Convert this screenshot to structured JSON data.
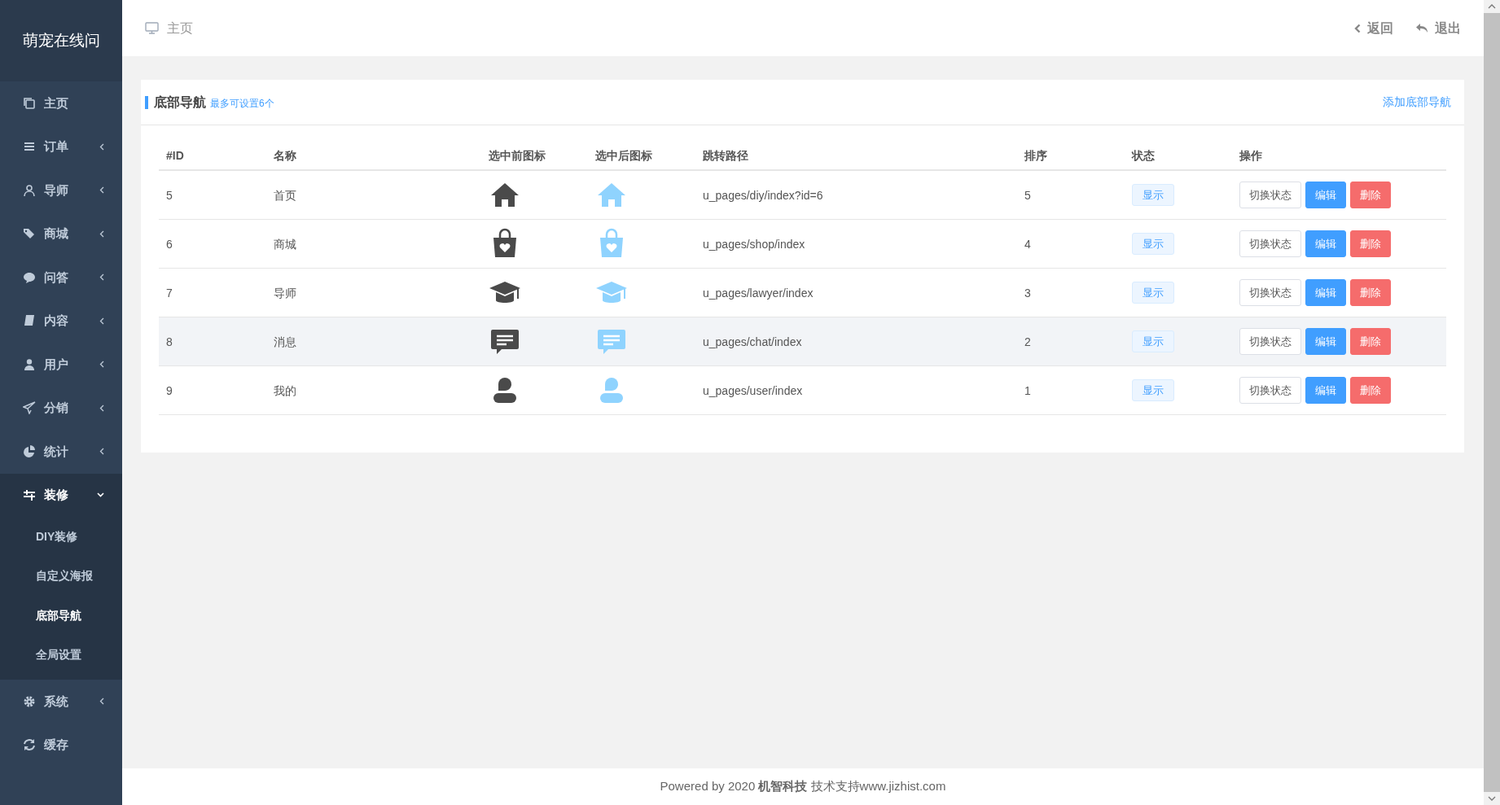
{
  "sidebar": {
    "logo": "萌宠在线问",
    "items": [
      {
        "label": "主页",
        "kind": "copy",
        "has_arrow": false,
        "expanded": false
      },
      {
        "label": "订单",
        "kind": "list",
        "has_arrow": true,
        "expanded": false
      },
      {
        "label": "导师",
        "kind": "user",
        "has_arrow": true,
        "expanded": false
      },
      {
        "label": "商城",
        "kind": "tags",
        "has_arrow": true,
        "expanded": false
      },
      {
        "label": "问答",
        "kind": "comment",
        "has_arrow": true,
        "expanded": false
      },
      {
        "label": "内容",
        "kind": "book",
        "has_arrow": true,
        "expanded": false
      },
      {
        "label": "用户",
        "kind": "person",
        "has_arrow": true,
        "expanded": false
      },
      {
        "label": "分销",
        "kind": "plane",
        "has_arrow": true,
        "expanded": false
      },
      {
        "label": "统计",
        "kind": "pie",
        "has_arrow": true,
        "expanded": false
      },
      {
        "label": "装修",
        "kind": "sliders",
        "has_arrow": true,
        "expanded": true,
        "children": [
          {
            "label": "DIY装修",
            "selected": false
          },
          {
            "label": "自定义海报",
            "selected": false
          },
          {
            "label": "底部导航",
            "selected": true
          },
          {
            "label": "全局设置",
            "selected": false
          }
        ]
      },
      {
        "label": "系统",
        "kind": "gear",
        "has_arrow": true,
        "expanded": false
      },
      {
        "label": "缓存",
        "kind": "refresh",
        "has_arrow": false,
        "expanded": false
      }
    ]
  },
  "header": {
    "breadcrumb": "主页",
    "back": "返回",
    "logout": "退出"
  },
  "card": {
    "title": "底部导航",
    "hint": "最多可设置6个",
    "add_link": "添加底部导航",
    "table": {
      "columns": [
        "#ID",
        "名称",
        "选中前图标",
        "选中后图标",
        "跳转路径",
        "排序",
        "状态",
        "操作"
      ],
      "rows": [
        {
          "id": "5",
          "name": "首页",
          "kind": "house",
          "path": "u_pages/diy/index?id=6",
          "sort": "5",
          "status": "显示",
          "highlighted": false,
          "actions": [
            "切换状态",
            "编辑",
            "删除"
          ]
        },
        {
          "id": "6",
          "name": "商城",
          "kind": "bag",
          "path": "u_pages/shop/index",
          "sort": "4",
          "status": "显示",
          "highlighted": false,
          "actions": [
            "切换状态",
            "编辑",
            "删除"
          ]
        },
        {
          "id": "7",
          "name": "导师",
          "kind": "cap",
          "path": "u_pages/lawyer/index",
          "sort": "3",
          "status": "显示",
          "highlighted": false,
          "actions": [
            "切换状态",
            "编辑",
            "删除"
          ]
        },
        {
          "id": "8",
          "name": "消息",
          "kind": "chat",
          "path": "u_pages/chat/index",
          "sort": "2",
          "status": "显示",
          "highlighted": true,
          "actions": [
            "切换状态",
            "编辑",
            "删除"
          ]
        },
        {
          "id": "9",
          "name": "我的",
          "kind": "person",
          "path": "u_pages/user/index",
          "sort": "1",
          "status": "显示",
          "highlighted": false,
          "actions": [
            "切换状态",
            "编辑",
            "删除"
          ]
        }
      ]
    }
  },
  "footer": "Powered by 2020 **机智科技** 技术支持www.jizhist.com"
}
